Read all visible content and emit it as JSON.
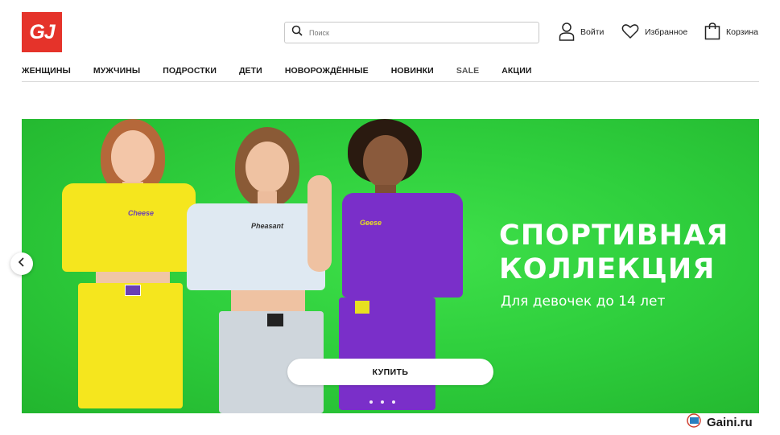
{
  "header": {
    "logo_text": "GJ",
    "search": {
      "placeholder": "Поиск",
      "value": ""
    },
    "actions": {
      "login": "Войти",
      "favorites": "Избранное",
      "cart": "Корзина"
    }
  },
  "nav": {
    "items": [
      "ЖЕНЩИНЫ",
      "МУЖЧИНЫ",
      "ПОДРОСТКИ",
      "ДЕТИ",
      "НОВОРОЖДЁННЫЕ",
      "НОВИНКИ",
      "SALE",
      "АКЦИИ"
    ]
  },
  "banner": {
    "title_line1": "СПОРТИВНАЯ",
    "title_line2": "КОЛЛЕКЦИЯ",
    "subtitle": "Для девочек до 14 лет",
    "button": "КУПИТЬ",
    "slide_dots": 3,
    "prints": {
      "left": "Cheese",
      "middle": "Pheasant",
      "right": "Geese"
    }
  },
  "colors": {
    "brand_red": "#e5332a",
    "banner_green": "#2fcf3d",
    "top_yellow": "#f5e61e",
    "top_lightblue": "#dfe9f2",
    "top_purple": "#7a2fc9"
  },
  "watermark": {
    "text": "Gaini.ru"
  }
}
